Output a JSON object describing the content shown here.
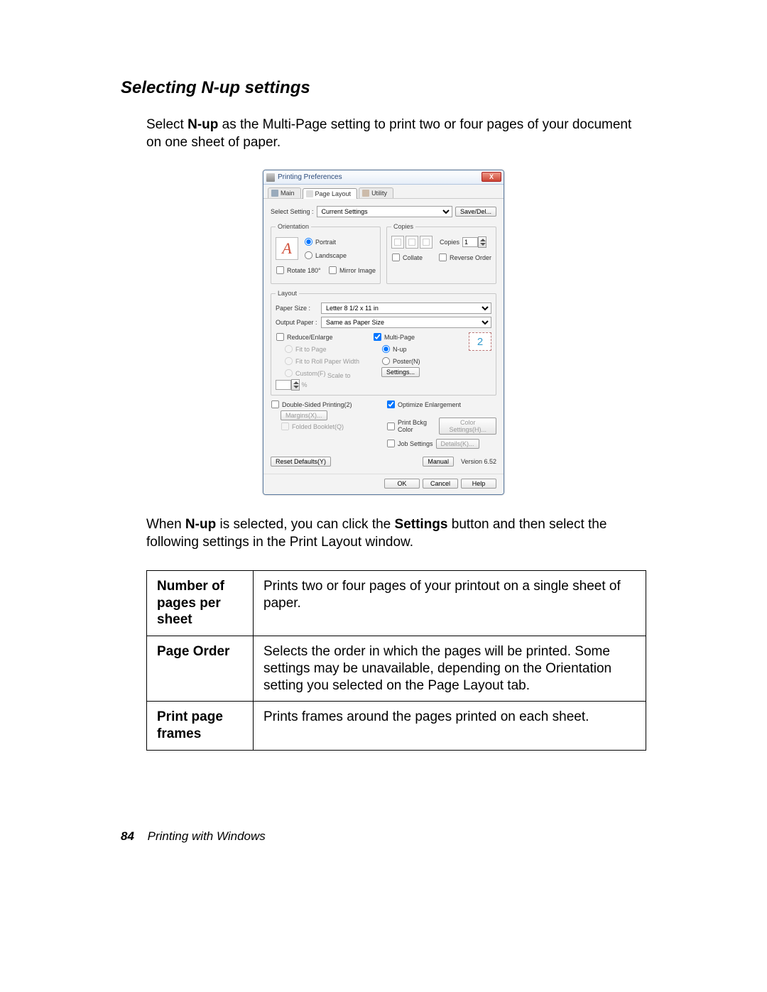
{
  "section": {
    "title": "Selecting N-up settings",
    "intro_before_bold": "Select ",
    "intro_bold": "N-up",
    "intro_after_bold": " as the Multi-Page setting to print two or four pages of your document on one sheet of paper.",
    "after1_a": "When ",
    "after1_b": "N-up",
    "after1_c": " is selected, you can click the ",
    "after1_d": "Settings",
    "after1_e": " button and then select the following settings in the Print Layout window."
  },
  "dialog": {
    "title": "Printing Preferences",
    "close_glyph": "X",
    "tabs": {
      "main": "Main",
      "layout": "Page Layout",
      "utility": "Utility"
    },
    "select_setting_lbl": "Select Setting :",
    "select_setting_val": "Current Settings",
    "save_del_btn": "Save/Del...",
    "orientation": {
      "legend": "Orientation",
      "swatch_letter": "A",
      "portrait": "Portrait",
      "landscape": "Landscape",
      "rotate": "Rotate 180°",
      "mirror": "Mirror Image"
    },
    "copies": {
      "legend": "Copies",
      "label": "Copies",
      "value": "1",
      "collate": "Collate",
      "reverse": "Reverse Order"
    },
    "layout": {
      "legend": "Layout",
      "paper_size_lbl": "Paper Size :",
      "paper_size_val": "Letter 8 1/2 x 11 in",
      "output_paper_lbl": "Output Paper :",
      "output_paper_val": "Same as Paper Size",
      "reduce_enlarge": "Reduce/Enlarge",
      "fit_page": "Fit to Page",
      "fit_roll": "Fit to Roll Paper Width",
      "custom": "Custom(F)",
      "scale_to": "Scale to",
      "scale_unit": "%",
      "multi_page": "Multi-Page",
      "nup": "N-up",
      "poster": "Poster(N)",
      "settings_btn": "Settings...",
      "nup_preview_number": "2"
    },
    "lower": {
      "double_sided": "Double-Sided Printing(2)",
      "margins_btn": "Margins(X)...",
      "folded_booklet": "Folded Booklet(Q)",
      "optimize": "Optimize Enlargement",
      "print_bckg": "Print Bckg Color",
      "color_settings_btn": "Color Settings(H)...",
      "job_settings": "Job Settings",
      "details_btn": "Details(K)...",
      "reset_defaults_btn": "Reset Defaults(Y)",
      "manual_btn": "Manual",
      "version": "Version 6.52"
    },
    "footer": {
      "ok": "OK",
      "cancel": "Cancel",
      "help": "Help"
    }
  },
  "table": {
    "r1h": "Number of pages per sheet",
    "r1v": "Prints two or four pages of your printout on a single sheet of paper.",
    "r2h": "Page Order",
    "r2v": "Selects the order in which the pages will be printed. Some settings may be unavailable, depending on the Orientation setting you selected on the Page Layout tab.",
    "r3h": "Print page frames",
    "r3v": "Prints frames around the pages printed on each sheet."
  },
  "footer": {
    "page": "84",
    "chapter": "Printing with Windows"
  }
}
